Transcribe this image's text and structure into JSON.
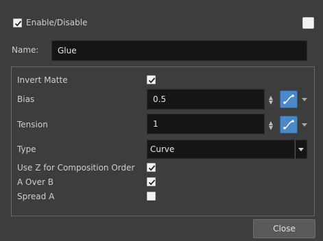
{
  "header": {
    "enable_label": "Enable/Disable",
    "enable_checked": true,
    "color_swatch": "#f2f2f2"
  },
  "name": {
    "label": "Name:",
    "value": "Glue"
  },
  "props": {
    "invert_matte": {
      "label": "Invert Matte",
      "checked": true
    },
    "bias": {
      "label": "Bias",
      "value": "0.5"
    },
    "tension": {
      "label": "Tension",
      "value": "1"
    },
    "type": {
      "label": "Type",
      "value": "Curve"
    },
    "use_z": {
      "label": "Use Z for Composition Order",
      "checked": true
    },
    "a_over_b": {
      "label": "A Over B",
      "checked": true
    },
    "spread_a": {
      "label": "Spread A",
      "checked": false
    }
  },
  "footer": {
    "close_label": "Close"
  },
  "colors": {
    "background": "#3d3d3d",
    "field": "#161616",
    "function_button": "#4a88c7"
  }
}
